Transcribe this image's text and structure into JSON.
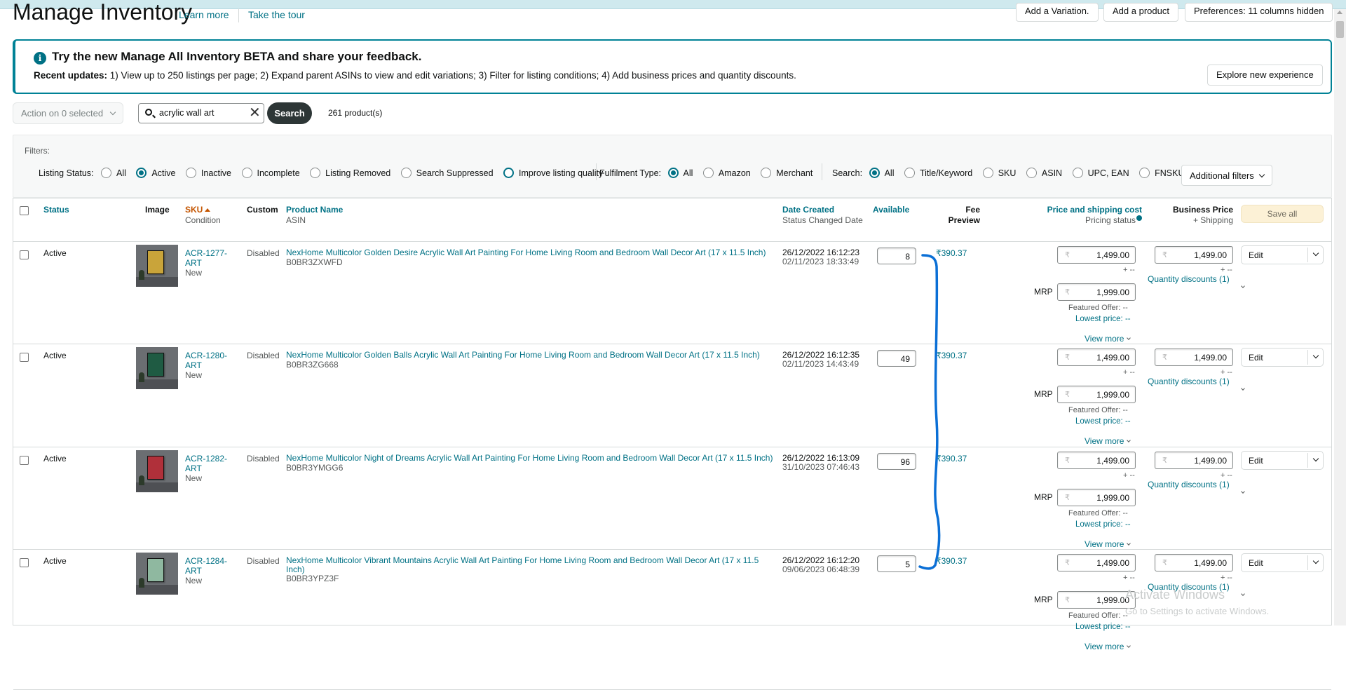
{
  "header": {
    "title": "Manage Inventory",
    "learn_more": "Learn more",
    "take_tour": "Take the tour",
    "add_variation": "Add a Variation.",
    "add_product": "Add a product",
    "preferences": "Preferences: 11 columns hidden"
  },
  "beta_banner": {
    "title": "Try the new Manage All Inventory BETA and share your feedback.",
    "updates_label": "Recent updates:",
    "updates_text": "1) View up to 250 listings per page; 2) Expand parent ASINs to view and edit variations; 3) Filter for listing conditions; 4) Add business prices and quantity discounts.",
    "explore_button": "Explore new experience"
  },
  "toolbar": {
    "action_dropdown": "Action on 0 selected",
    "search_value": "acrylic wall art",
    "search_button": "Search",
    "product_count": "261 product(s)"
  },
  "filters": {
    "label": "Filters:",
    "listing_status_label": "Listing Status:",
    "listing_status_options": [
      "All",
      "Active",
      "Inactive",
      "Incomplete",
      "Listing Removed",
      "Search Suppressed",
      "Improve listing quality"
    ],
    "listing_status_selected": "Active",
    "fulfilment_label": "Fulfilment Type:",
    "fulfilment_options": [
      "All",
      "Amazon",
      "Merchant"
    ],
    "fulfilment_selected": "All",
    "search_label": "Search:",
    "search_options": [
      "All",
      "Title/Keyword",
      "SKU",
      "ASIN",
      "UPC, EAN",
      "FNSKU"
    ],
    "search_selected": "All",
    "additional_filters": "Additional filters"
  },
  "table": {
    "headers": {
      "status": "Status",
      "image": "Image",
      "sku": "SKU",
      "condition": "Condition",
      "custom": "Custom",
      "product_name": "Product Name",
      "asin": "ASIN",
      "date_created": "Date Created",
      "status_changed": "Status Changed Date",
      "available": "Available",
      "fee": "Fee",
      "fee_preview": "Preview",
      "price_shipping": "Price and shipping cost",
      "pricing_status": "Pricing status",
      "business_price": "Business Price",
      "plus_shipping": "+ Shipping",
      "save_all": "Save all"
    },
    "rows": [
      {
        "status": "Active",
        "sku_line1": "ACR-1277-",
        "sku_line2": "ART",
        "condition": "New",
        "custom": "Disabled",
        "name": "NexHome Multicolor Golden Desire Acrylic Wall Art Painting For Home Living Room and Bedroom Wall Decor Art (17 x 11.5 Inch)",
        "asin": "B0BR3ZXWFD",
        "date_created": "26/12/2022 16:12:23",
        "status_changed": "02/11/2023 18:33:49",
        "available": "8",
        "fee": "₹390.37",
        "currency": "₹",
        "price": "1,499.00",
        "shipping": "+ --",
        "mrp_label": "MRP",
        "mrp": "1,999.00",
        "featured_offer": "Featured Offer: --",
        "lowest_price": "Lowest price: --",
        "view_more": "View more",
        "business_price": "1,499.00",
        "business_shipping": "+ --",
        "quantity_discounts": "Quantity discounts (1)",
        "edit": "Edit",
        "frame_color": "#c9a43a"
      },
      {
        "status": "Active",
        "sku_line1": "ACR-1280-",
        "sku_line2": "ART",
        "condition": "New",
        "custom": "Disabled",
        "name": "NexHome Multicolor Golden Balls Acrylic Wall Art Painting For Home Living Room and Bedroom Wall Decor Art (17 x 11.5 Inch)",
        "asin": "B0BR3ZG668",
        "date_created": "26/12/2022 16:12:35",
        "status_changed": "02/11/2023 14:43:49",
        "available": "49",
        "fee": "₹390.37",
        "currency": "₹",
        "price": "1,499.00",
        "shipping": "+ --",
        "mrp_label": "MRP",
        "mrp": "1,999.00",
        "featured_offer": "Featured Offer: --",
        "lowest_price": "Lowest price: --",
        "view_more": "View more",
        "business_price": "1,499.00",
        "business_shipping": "+ --",
        "quantity_discounts": "Quantity discounts (1)",
        "edit": "Edit",
        "frame_color": "#1f5b43"
      },
      {
        "status": "Active",
        "sku_line1": "ACR-1282-",
        "sku_line2": "ART",
        "condition": "New",
        "custom": "Disabled",
        "name": "NexHome Multicolor Night of Dreams Acrylic Wall Art Painting For Home Living Room and Bedroom Wall Decor Art (17 x 11.5 Inch)",
        "asin": "B0BR3YMGG6",
        "date_created": "26/12/2022 16:13:09",
        "status_changed": "31/10/2023 07:46:43",
        "available": "96",
        "fee": "₹390.37",
        "currency": "₹",
        "price": "1,499.00",
        "shipping": "+ --",
        "mrp_label": "MRP",
        "mrp": "1,999.00",
        "featured_offer": "Featured Offer: --",
        "lowest_price": "Lowest price: --",
        "view_more": "View more",
        "business_price": "1,499.00",
        "business_shipping": "+ --",
        "quantity_discounts": "Quantity discounts (1)",
        "edit": "Edit",
        "frame_color": "#b0303a"
      },
      {
        "status": "Active",
        "sku_line1": "ACR-1284-",
        "sku_line2": "ART",
        "condition": "New",
        "custom": "Disabled",
        "name": "NexHome Multicolor Vibrant Mountains Acrylic Wall Art Painting For Home Living Room and Bedroom Wall Decor Art (17 x 11.5 Inch)",
        "asin": "B0BR3YPZ3F",
        "date_created": "26/12/2022 16:12:20",
        "status_changed": "09/06/2023 06:48:39",
        "available": "5",
        "fee": "₹390.37",
        "currency": "₹",
        "price": "1,499.00",
        "shipping": "+ --",
        "mrp_label": "MRP",
        "mrp": "1,999.00",
        "featured_offer": "Featured Offer: --",
        "lowest_price": "Lowest price: --",
        "view_more": "View more",
        "business_price": "1,499.00",
        "business_shipping": "+ --",
        "quantity_discounts": "Quantity discounts (1)",
        "edit": "Edit",
        "frame_color": "#8fb8a0"
      }
    ]
  },
  "os_watermark": {
    "line1": "Activate Windows",
    "line2": "Go to Settings to activate Windows."
  },
  "colors": {
    "accent": "#007185",
    "sort": "#c45500",
    "annotation": "#0a6fd6",
    "save_all_bg": "#fcf1d6"
  }
}
